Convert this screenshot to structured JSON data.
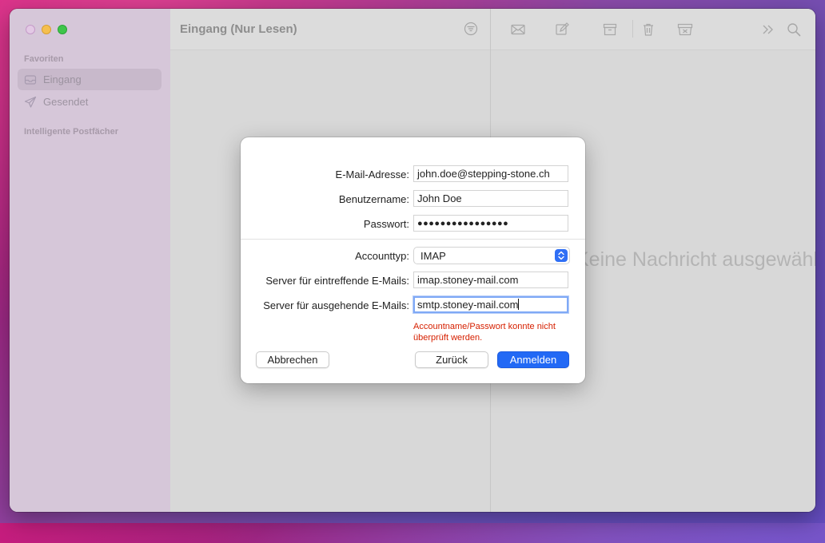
{
  "sidebar": {
    "section_favorites": "Favoriten",
    "items": [
      {
        "label": "Eingang",
        "icon": "inbox-icon",
        "active": true
      },
      {
        "label": "Gesendet",
        "icon": "paper-plane-icon",
        "active": false
      }
    ],
    "section_smart": "Intelligente Postfächer"
  },
  "list": {
    "title": "Eingang (Nur Lesen)"
  },
  "message": {
    "empty_text": "Keine Nachricht ausgewählt"
  },
  "dialog": {
    "email_label": "E-Mail-Adresse:",
    "email_value": "john.doe@stepping-stone.ch",
    "username_label": "Benutzername:",
    "username_value": "John Doe",
    "password_label": "Passwort:",
    "password_value": "●●●●●●●●●●●●●●●●",
    "account_type_label": "Accounttyp:",
    "account_type_value": "IMAP",
    "incoming_label": "Server für eintreffende E-Mails:",
    "incoming_value": "imap.stoney-mail.com",
    "outgoing_label": "Server für ausgehende E-Mails:",
    "outgoing_value": "smtp.stoney-mail.com",
    "error_text": "Accountname/Passwort konnte nicht überprüft werden.",
    "cancel_label": "Abbrechen",
    "back_label": "Zurück",
    "signin_label": "Anmelden"
  },
  "colors": {
    "accent": "#2269f5",
    "error": "#d62000"
  }
}
